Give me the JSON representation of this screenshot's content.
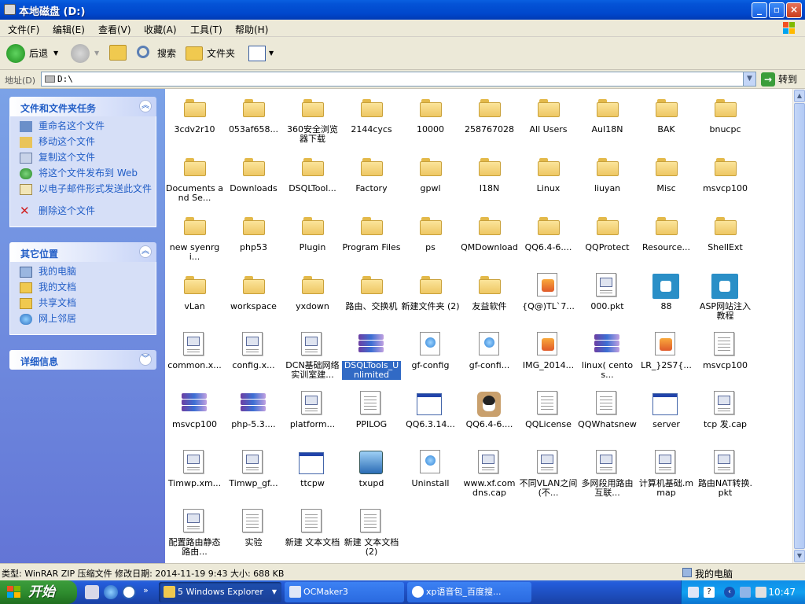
{
  "window": {
    "title": "本地磁盘 (D:)"
  },
  "menu": [
    "文件(F)",
    "编辑(E)",
    "查看(V)",
    "收藏(A)",
    "工具(T)",
    "帮助(H)"
  ],
  "toolbar": {
    "back": "后退",
    "search": "搜索",
    "folders": "文件夹"
  },
  "address": {
    "label": "地址(D)",
    "value": "D:\\",
    "go": "转到"
  },
  "sidebar": {
    "tasks": {
      "title": "文件和文件夹任务",
      "items": [
        "重命名这个文件",
        "移动这个文件",
        "复制这个文件",
        "将这个文件发布到 Web",
        "以电子邮件形式发送此文件",
        "删除这个文件"
      ]
    },
    "places": {
      "title": "其它位置",
      "items": [
        "我的电脑",
        "我的文档",
        "共享文档",
        "网上邻居"
      ]
    },
    "details": {
      "title": "详细信息"
    }
  },
  "files": [
    {
      "name": "3cdv2r10",
      "type": "folder"
    },
    {
      "name": "053af658...",
      "type": "folder"
    },
    {
      "name": "360安全浏览器下载",
      "type": "folder"
    },
    {
      "name": "2144cycs",
      "type": "folder"
    },
    {
      "name": "10000",
      "type": "folder"
    },
    {
      "name": "258767028",
      "type": "folder"
    },
    {
      "name": "All Users",
      "type": "folder"
    },
    {
      "name": "AuI18N",
      "type": "folder"
    },
    {
      "name": "BAK",
      "type": "folder"
    },
    {
      "name": "bnucpc",
      "type": "folder"
    },
    {
      "name": "Documents and Se...",
      "type": "folder"
    },
    {
      "name": "Downloads",
      "type": "folder"
    },
    {
      "name": "DSQLTool...",
      "type": "folder"
    },
    {
      "name": "Factory",
      "type": "folder"
    },
    {
      "name": "gpwl",
      "type": "folder"
    },
    {
      "name": "I18N",
      "type": "folder"
    },
    {
      "name": "Linux",
      "type": "folder"
    },
    {
      "name": "liuyan",
      "type": "folder"
    },
    {
      "name": "Misc",
      "type": "folder"
    },
    {
      "name": "msvcp100",
      "type": "folder"
    },
    {
      "name": "new syenrgi...",
      "type": "folder"
    },
    {
      "name": "php53",
      "type": "folder"
    },
    {
      "name": "Plugin",
      "type": "folder"
    },
    {
      "name": "Program Files",
      "type": "folder"
    },
    {
      "name": "ps",
      "type": "folder"
    },
    {
      "name": "QMDownload",
      "type": "folder"
    },
    {
      "name": "QQ6.4-6....",
      "type": "folder"
    },
    {
      "name": "QQProtect",
      "type": "folder"
    },
    {
      "name": "Resource...",
      "type": "folder"
    },
    {
      "name": "ShellExt",
      "type": "folder"
    },
    {
      "name": "vLan",
      "type": "folder"
    },
    {
      "name": "workspace",
      "type": "folder"
    },
    {
      "name": "yxdown",
      "type": "folder"
    },
    {
      "name": "路由、交换机",
      "type": "folder"
    },
    {
      "name": "新建文件夹 (2)",
      "type": "folder"
    },
    {
      "name": "友益软件",
      "type": "folder"
    },
    {
      "name": "{Q@)TL`7...",
      "type": "image"
    },
    {
      "name": "000.pkt",
      "type": "doc"
    },
    {
      "name": "88",
      "type": "puzzle"
    },
    {
      "name": "ASP网站注入教程",
      "type": "puzzle"
    },
    {
      "name": "common.x...",
      "type": "doc"
    },
    {
      "name": "config.x...",
      "type": "doc"
    },
    {
      "name": "DCN基础网络实训室建...",
      "type": "doc"
    },
    {
      "name": "DSQLTools_Unlimited",
      "type": "rar",
      "selected": true
    },
    {
      "name": "gf-config",
      "type": "globe"
    },
    {
      "name": "gf-confi...",
      "type": "globe"
    },
    {
      "name": "IMG_2014...",
      "type": "image"
    },
    {
      "name": "linux( centos...",
      "type": "rar"
    },
    {
      "name": "LR_}2S7{...",
      "type": "image"
    },
    {
      "name": "msvcp100",
      "type": "text"
    },
    {
      "name": "msvcp100",
      "type": "rar"
    },
    {
      "name": "php-5.3....",
      "type": "rar"
    },
    {
      "name": "platform...",
      "type": "doc"
    },
    {
      "name": "PPILOG",
      "type": "text"
    },
    {
      "name": "QQ6.3.14...",
      "type": "app"
    },
    {
      "name": "QQ6.4-6....",
      "type": "qq"
    },
    {
      "name": "QQLicense",
      "type": "text"
    },
    {
      "name": "QQWhatsnew",
      "type": "text"
    },
    {
      "name": "server",
      "type": "app"
    },
    {
      "name": "tcp 发.cap",
      "type": "doc"
    },
    {
      "name": "Timwp.xm...",
      "type": "doc"
    },
    {
      "name": "Timwp_gf...",
      "type": "doc"
    },
    {
      "name": "ttcpw",
      "type": "app"
    },
    {
      "name": "txupd",
      "type": "setup"
    },
    {
      "name": "Uninstall",
      "type": "globe"
    },
    {
      "name": "www.xf.com dns.cap",
      "type": "doc"
    },
    {
      "name": "不同VLAN之间(不...",
      "type": "doc"
    },
    {
      "name": "多网段用路由互联...",
      "type": "doc"
    },
    {
      "name": "计算机基础.mmap",
      "type": "doc"
    },
    {
      "name": "路由NAT转换.pkt",
      "type": "doc"
    },
    {
      "name": "配置路由静态路由...",
      "type": "doc"
    },
    {
      "name": "实验",
      "type": "text"
    },
    {
      "name": "新建 文本文档",
      "type": "text"
    },
    {
      "name": "新建 文本文档 (2)",
      "type": "text"
    }
  ],
  "status": {
    "text": "类型: WinRAR ZIP 压缩文件 修改日期: 2014-11-19 9:43 大小: 688 KB",
    "location": "我的电脑"
  },
  "taskbar": {
    "start": "开始",
    "tasks": [
      "5 Windows Explorer",
      "OCMaker3",
      "xp语音包_百度搜..."
    ],
    "clock": "10:47"
  }
}
